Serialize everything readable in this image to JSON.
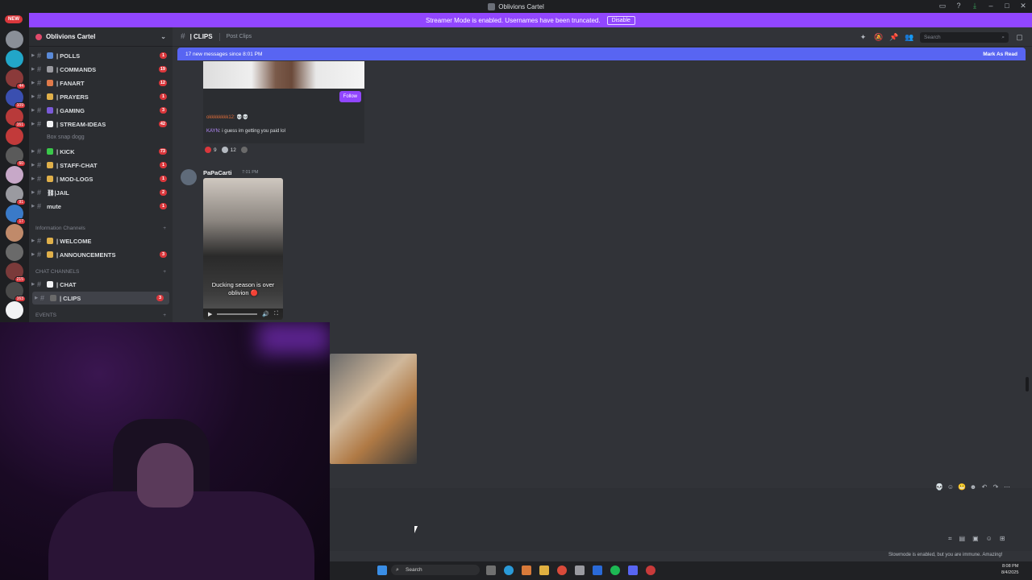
{
  "window": {
    "title": "Oblivions Cartel"
  },
  "banner": {
    "text": "Streamer Mode is enabled. Usernames have been truncated.",
    "disable_label": "Disable",
    "new_badge": "NEW"
  },
  "guilds": [
    {
      "badge": "",
      "color": "#8a8f98"
    },
    {
      "badge": "",
      "color": "#22a6c8"
    },
    {
      "badge": "44",
      "color": "#8b3a3a"
    },
    {
      "badge": "109",
      "color": "#3a4fb0"
    },
    {
      "badge": "161",
      "color": "#b83a3a"
    },
    {
      "badge": "",
      "color": "#c23a3a"
    },
    {
      "badge": "60",
      "color": "#5a5a5a"
    },
    {
      "badge": "",
      "color": "#c7a8c8"
    },
    {
      "badge": "91",
      "color": "#9a9aa0"
    },
    {
      "badge": "17",
      "color": "#3a7ac8"
    },
    {
      "badge": "",
      "color": "#c08a6a"
    },
    {
      "badge": "",
      "color": "#6a6a6a"
    },
    {
      "badge": "215",
      "color": "#7a3a3a"
    },
    {
      "badge": "163",
      "color": "#4a4a4a"
    },
    {
      "badge": "",
      "color": "#f2f3f5"
    }
  ],
  "server": {
    "name": "Oblivions Cartel"
  },
  "channels": [
    {
      "label": "| POLLS",
      "badge": "1",
      "emoji": "#5a8ad8"
    },
    {
      "label": "| COMMANDS",
      "badge": "19",
      "emoji": "#9a9aa0"
    },
    {
      "label": "| FANART",
      "badge": "12",
      "emoji": "#e07a4a"
    },
    {
      "label": "| PRAYERS",
      "badge": "1",
      "emoji": "#e0b04a"
    },
    {
      "label": "| GAMING",
      "badge": "3",
      "emoji": "#7a5ad8"
    },
    {
      "label": "| STREAM-IDEAS",
      "badge": "42",
      "emoji": "#f2f3f5"
    }
  ],
  "thread": {
    "label": "Box snap dogg"
  },
  "channels2": [
    {
      "label": "| KICK",
      "badge": "73",
      "emoji": "#3ac84a"
    },
    {
      "label": "| STAFF-CHAT",
      "badge": "1",
      "emoji": "#e0b04a"
    },
    {
      "label": "| MOD-LOGS",
      "badge": "1",
      "emoji": "#e0b04a"
    },
    {
      "label": "⛓|JAIL",
      "badge": "2",
      "emoji": ""
    },
    {
      "label": "mute",
      "badge": "1",
      "emoji": ""
    }
  ],
  "categories": {
    "information": "Information Channels",
    "chat": "CHAT CHANNELS",
    "events": "EVENTS"
  },
  "info_channels": [
    {
      "label": "| WELCOME",
      "badge": "",
      "emoji": "#e0b04a"
    },
    {
      "label": "| ANNOUNCEMENTS",
      "badge": "3",
      "emoji": "#e0b04a"
    }
  ],
  "chat_channels": [
    {
      "label": "| CHAT",
      "badge": "",
      "emoji": "#f2f3f5"
    },
    {
      "label": "| CLIPS",
      "badge": "3",
      "emoji": "#6a6a6a"
    }
  ],
  "header": {
    "channel": "| CLIPS",
    "topic": "Post Clips",
    "search_placeholder": "Search"
  },
  "new_messages": {
    "text": "17 new messages since 8:01 PM",
    "mark_label": "Mark As Read"
  },
  "embed": {
    "follow_label": "Follow",
    "line1": "okkkkkkkk12: 💀💀",
    "user": "KAYN",
    "line2": ": i guess im getting you paid lol"
  },
  "reactions": [
    {
      "count": "9",
      "color": "#da373c"
    },
    {
      "count": "12",
      "color": "#b5bac1"
    },
    {
      "count": "",
      "color": "#6a6a6a"
    }
  ],
  "message": {
    "author": "PaPaCarti",
    "time": "7:01 PM",
    "caption": "Ducking season is over oblivion 🔴"
  },
  "footer": {
    "slowmode": "Slowmode is enabled, but you are immune. Amazing!"
  },
  "taskbar": {
    "search": "Search",
    "time": "8:08 PM",
    "date": "8/4/2025"
  }
}
